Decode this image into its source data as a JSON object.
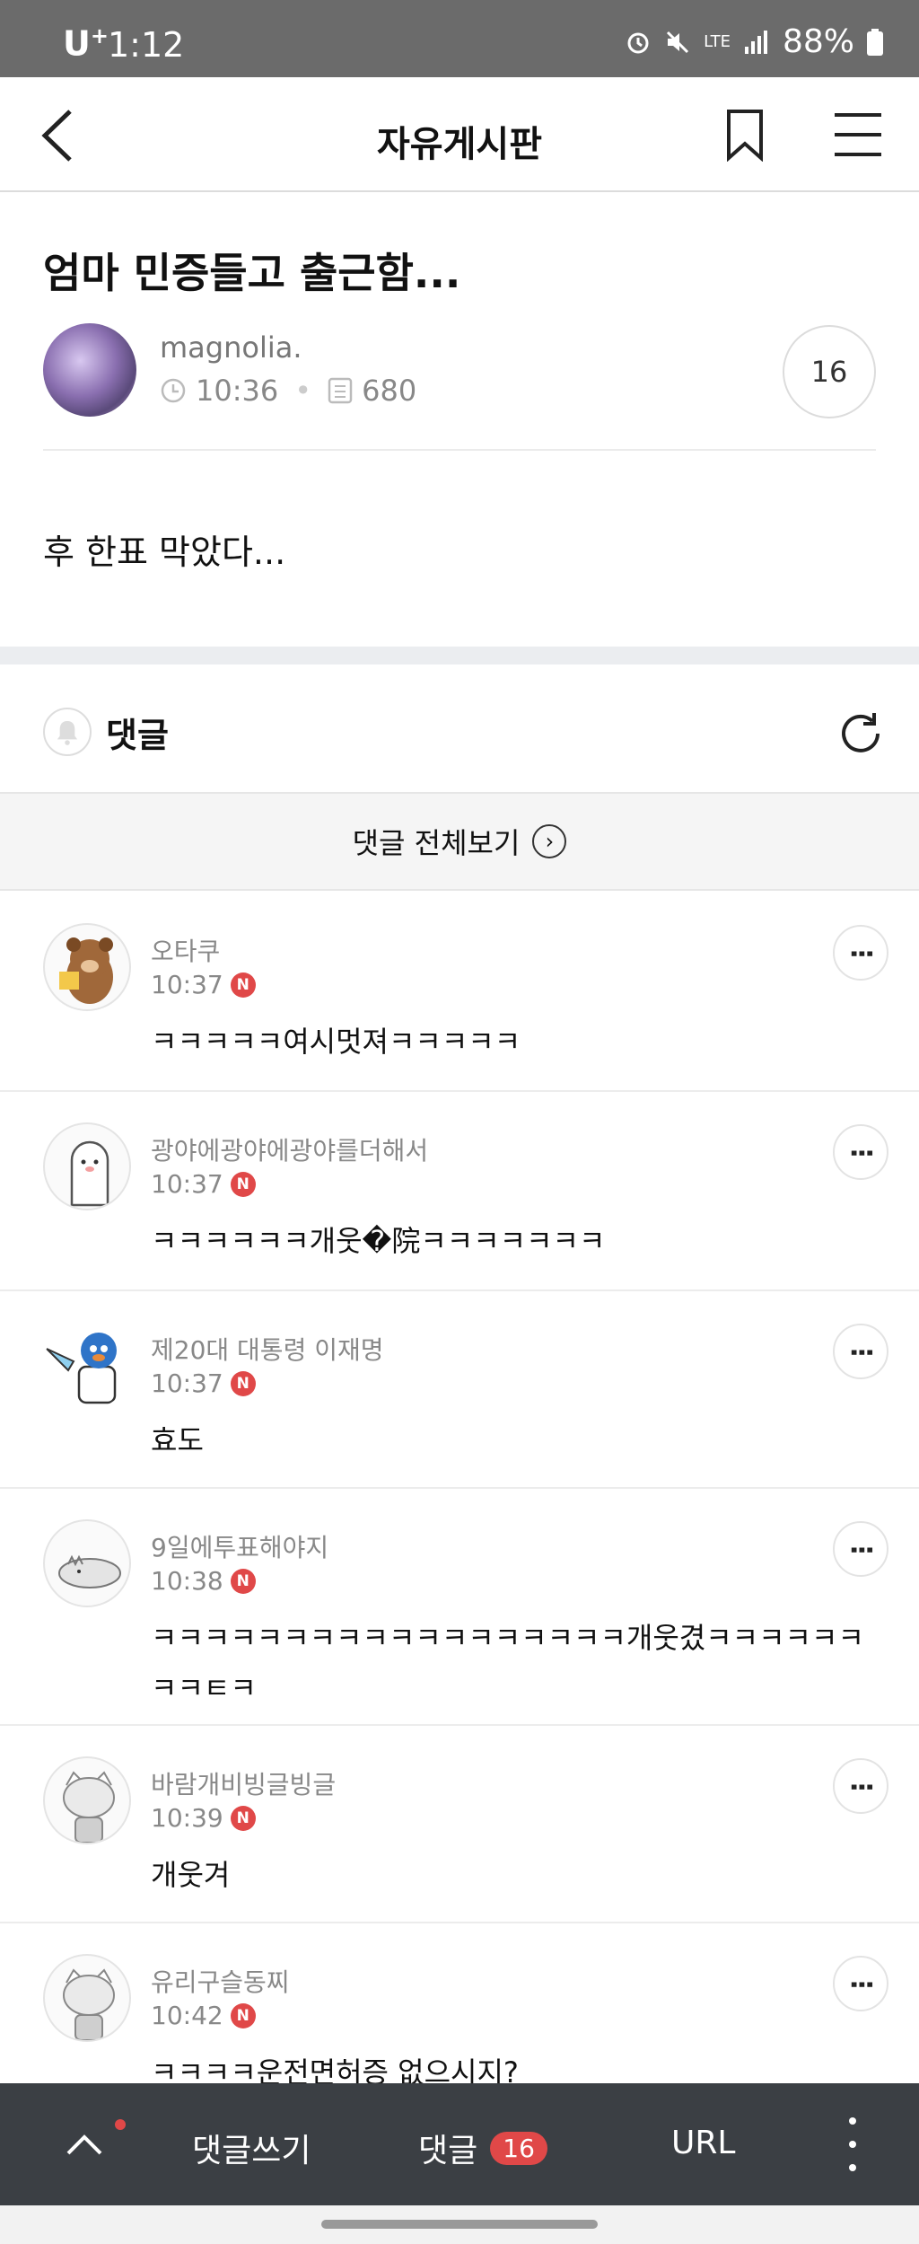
{
  "statusbar": {
    "carrier": "U",
    "carrier_sup": "+",
    "time": "1:12",
    "battery": "88%",
    "net": "LTE"
  },
  "appbar": {
    "title": "자유게시판"
  },
  "post": {
    "title": "엄마 민증들고 출근함...",
    "author": "magnolia.",
    "time": "10:36",
    "views": "680",
    "comment_count": "16",
    "body": "후 한표 막았다..."
  },
  "comments_section": {
    "label": "댓글",
    "view_all": "댓글 전체보기",
    "badge_letter": "N"
  },
  "comments": [
    {
      "name": "오타쿠",
      "time": "10:37",
      "text": "ㅋㅋㅋㅋㅋ여시멋져ㅋㅋㅋㅋㅋ"
    },
    {
      "name": "광야에광야에광야를더해서",
      "time": "10:37",
      "text": "ㅋㅋㅋㅋㅋㅋ개웃�院ㅋㅋㅋㅋㅋㅋㅋ"
    },
    {
      "name": "제20대 대통령 이재명",
      "time": "10:37",
      "text": "효도"
    },
    {
      "name": "9일에투표해야지",
      "time": "10:38",
      "text": "ㅋㅋㅋㅋㅋㅋㅋㅋㅋㅋㅋㅋㅋㅋㅋㅋㅋㅋ개웃겼ㅋㅋㅋㅋㅋㅋㅋㅋㅌㅋ"
    },
    {
      "name": "바람개비빙글빙글",
      "time": "10:39",
      "text": "개웃겨"
    },
    {
      "name": "유리구슬동찌",
      "time": "10:42",
      "text": "ㅋㅋㅋㅋ운전면허증 없으시지?"
    }
  ],
  "bottombar": {
    "write": "댓글쓰기",
    "comments": "댓글",
    "comments_count": "16",
    "url": "URL"
  }
}
